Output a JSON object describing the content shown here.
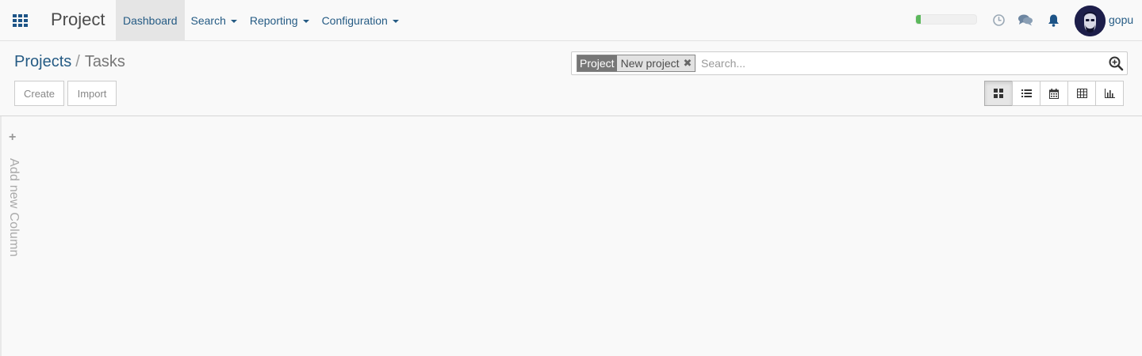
{
  "navbar": {
    "app_title": "Project",
    "menu": [
      {
        "label": "Dashboard",
        "active": true,
        "dropdown": false
      },
      {
        "label": "Search",
        "active": false,
        "dropdown": true
      },
      {
        "label": "Reporting",
        "active": false,
        "dropdown": true
      },
      {
        "label": "Configuration",
        "active": false,
        "dropdown": true
      }
    ],
    "progress_percent": 8,
    "progress_color": "#5cb85c",
    "icons": [
      "apps-grid-icon",
      "clock-icon",
      "chat-icon",
      "bell-icon"
    ],
    "username": "gopu"
  },
  "breadcrumb": {
    "parent": "Projects",
    "separator": "/",
    "current": "Tasks"
  },
  "search": {
    "facet_label": "Project",
    "facet_value": "New project",
    "placeholder": "Search...",
    "value": ""
  },
  "buttons": {
    "create": "Create",
    "import": "Import"
  },
  "views": [
    {
      "name": "kanban",
      "icon": "kanban-grid-icon",
      "active": true
    },
    {
      "name": "list",
      "icon": "list-icon",
      "active": false
    },
    {
      "name": "calendar",
      "icon": "calendar-icon",
      "active": false
    },
    {
      "name": "pivot",
      "icon": "table-icon",
      "active": false
    },
    {
      "name": "graph",
      "icon": "bar-chart-icon",
      "active": false
    }
  ],
  "kanban": {
    "add_column_symbol": "+",
    "add_column_label": "Add new Column"
  },
  "colors": {
    "link": "#255b84",
    "background": "#f9f9f9",
    "bell": "#1d5487",
    "avatar_bg": "#1d1e4a"
  }
}
